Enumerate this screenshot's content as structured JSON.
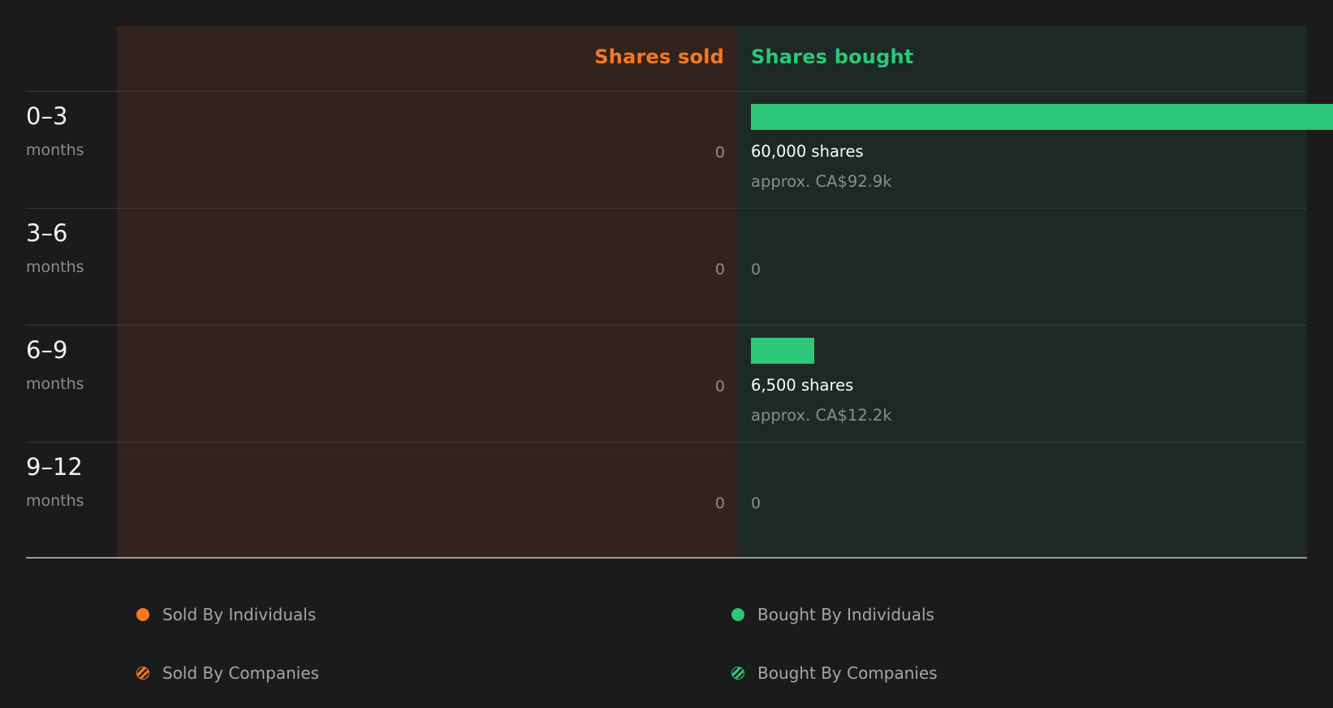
{
  "colors": {
    "sold": "#f97a1e",
    "bought": "#2ec77a",
    "muted": "#8c8c8c",
    "legend_text": "#a6a6a6"
  },
  "chart_data": {
    "type": "bar",
    "headers": {
      "sold": "Shares sold",
      "bought": "Shares bought"
    },
    "categories": [
      {
        "range": "0–3",
        "unit": "months"
      },
      {
        "range": "3–6",
        "unit": "months"
      },
      {
        "range": "6–9",
        "unit": "months"
      },
      {
        "range": "9–12",
        "unit": "months"
      }
    ],
    "series": [
      {
        "name": "Shares sold",
        "values": [
          0,
          0,
          0,
          0
        ],
        "labels": [
          "0",
          "0",
          "0",
          "0"
        ]
      },
      {
        "name": "Shares bought",
        "values": [
          60000,
          0,
          6500,
          0
        ],
        "labels": [
          "60,000 shares",
          "0",
          "6,500 shares",
          "0"
        ],
        "approx_values": [
          "approx. CA$92.9k",
          "",
          "approx. CA$12.2k",
          ""
        ]
      }
    ],
    "legend": [
      {
        "label": "Sold By Individuals",
        "marker": "dot-solid-orange"
      },
      {
        "label": "Bought By Individuals",
        "marker": "dot-solid-green"
      },
      {
        "label": "Sold By Companies",
        "marker": "dot-hatched-orange"
      },
      {
        "label": "Bought By Companies",
        "marker": "dot-hatched-green"
      }
    ]
  }
}
